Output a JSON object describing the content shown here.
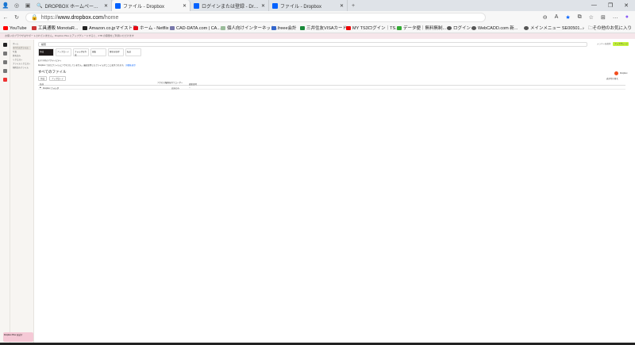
{
  "browser": {
    "tabs": [
      {
        "title": "DROPBOX ホームページ 表示おかしい"
      },
      {
        "title": "ファイル - Dropbox"
      },
      {
        "title": "ログインまたは登録 - Dropbox"
      },
      {
        "title": "ファイル - Dropbox"
      }
    ],
    "url_prefix": "https://",
    "url_host": "www.dropbox.com",
    "url_path": "/home",
    "bookmarks": [
      "YouTube",
      "工具通販 MonotaR...",
      "Amazon.co.jpマイストア",
      "ホーム - Netflix",
      "CAD-DATA.com | CA...",
      "個人向けインターネット...",
      "freee会計",
      "三井住友VISAカード",
      "MY TS3ログイン｜TS...",
      "データ便｜無料無制...",
      "ログイン",
      "WebCADD.com 新...",
      "メインメニュー SE00501...",
      "その他のお気に入り"
    ]
  },
  "page": {
    "banner": "お使いのブラウザはサポートされていません。Dropbox Plus にアップグレードすると、2TB の容量をご利用いただけます",
    "sidebar": {
      "items": [
        "すべてのファイル",
        "写真",
        "共有済み",
        "リクエスト",
        "ファイルリクエスト",
        "削除済みファイル"
      ],
      "section": "ホーム",
      "promo": "Dropbox Plus を試す"
    },
    "search_placeholder": "検索",
    "invite_label": "メンバーを招待",
    "upgrade_label": "アップグレード",
    "quick": [
      {
        "label": "作成"
      },
      {
        "label": "アップロード"
      },
      {
        "label": "フォルダを作成"
      },
      {
        "label": "編集"
      },
      {
        "label": "署名を取得"
      },
      {
        "label": "転送"
      }
    ],
    "suggested": "おすすめのアクティビティ",
    "info": "Dropbox でまだファイルにアクセスしていません。最近使用したファイルがここに表示されます。",
    "info_link": "詳細を表示",
    "heading": "すべてのファイル",
    "actions": [
      "作成",
      "アップロード"
    ],
    "columns": [
      "名前",
      "アクセス権限を持つユーザー",
      "更新日時"
    ],
    "rows": [
      {
        "name": "Dropbox フォルダ",
        "access": "自分のみ",
        "modified": "--"
      }
    ],
    "right_label": "Dropbox",
    "view_label": "表示切り替え"
  }
}
